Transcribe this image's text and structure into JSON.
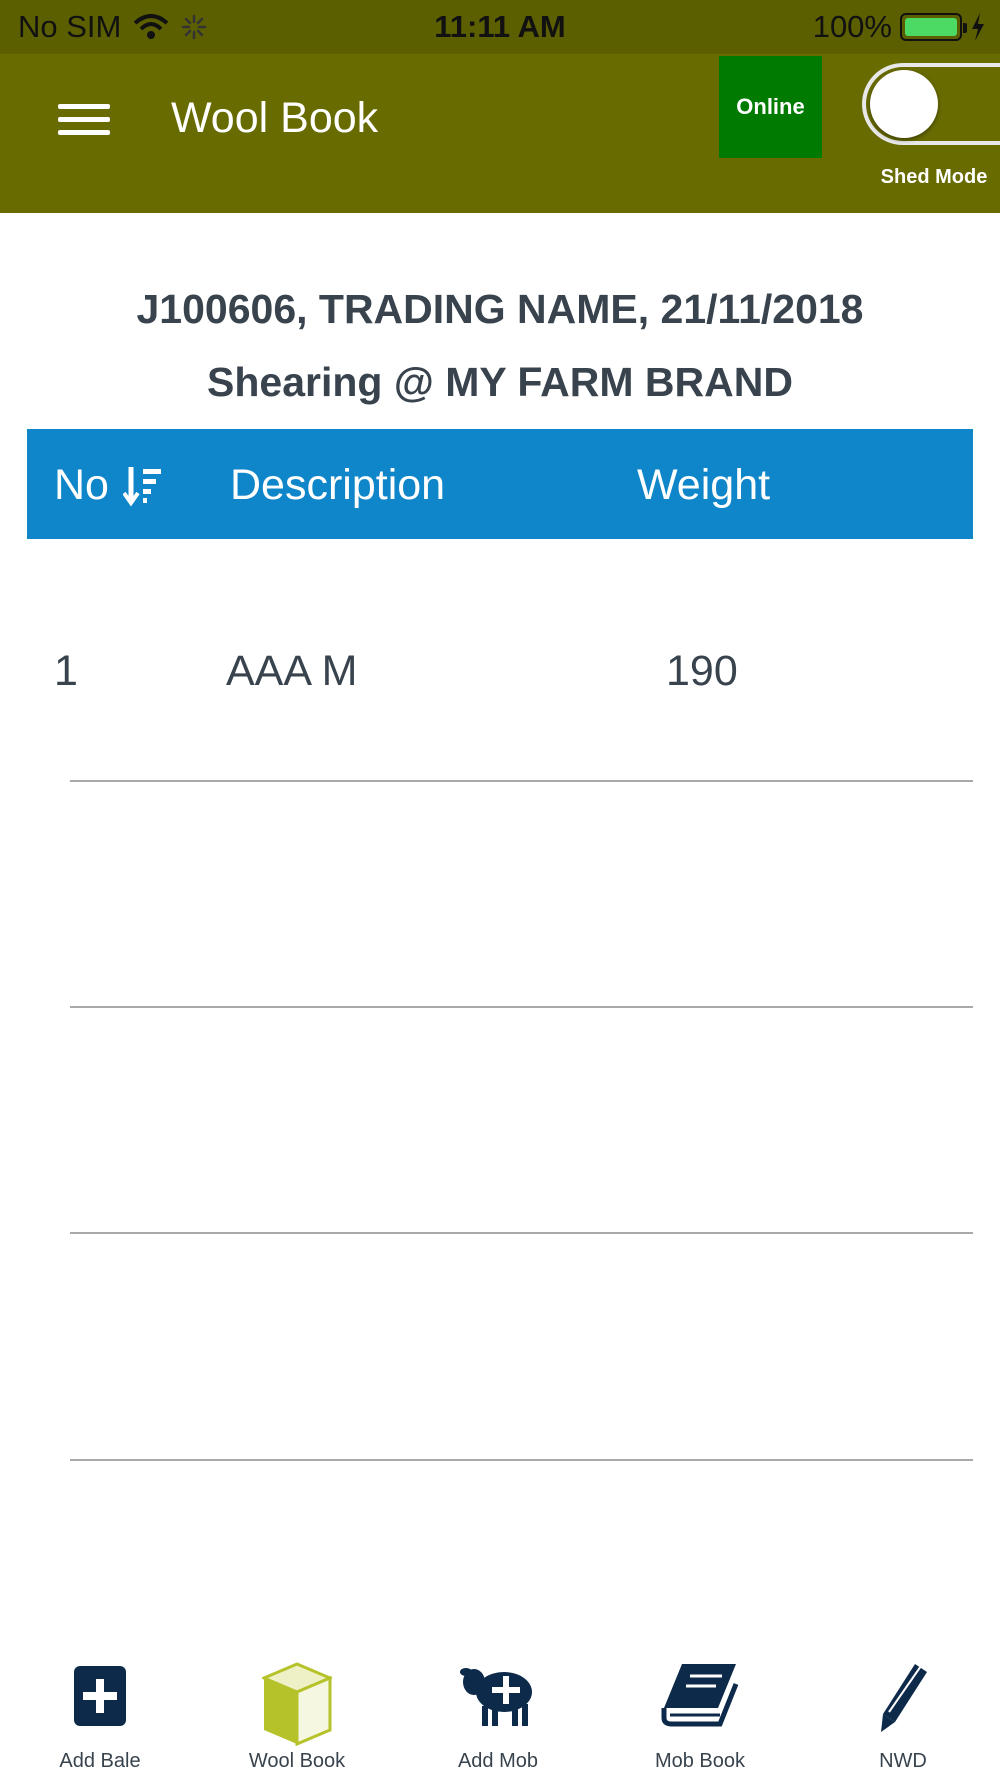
{
  "status_bar": {
    "carrier": "No SIM",
    "time": "11:11 AM",
    "battery_percent": "100%",
    "battery_level": 1.0
  },
  "header": {
    "title": "Wool Book",
    "online_label": "Online",
    "shed_mode_label": "Shed Mode",
    "shed_mode_on": false
  },
  "job": {
    "title": "J100606, TRADING NAME, 21/11/2018",
    "subtitle": "Shearing @ MY FARM BRAND"
  },
  "table": {
    "columns": [
      "No",
      "Description",
      "Weight"
    ],
    "rows": [
      {
        "no": "1",
        "description": "AAA M",
        "weight": "190"
      }
    ]
  },
  "tabs": [
    {
      "label": "Add Bale",
      "icon": "add-bale-icon"
    },
    {
      "label": "Wool Book",
      "icon": "wool-book-icon",
      "active": true
    },
    {
      "label": "Add Mob",
      "icon": "add-mob-icon"
    },
    {
      "label": "Mob Book",
      "icon": "mob-book-icon"
    },
    {
      "label": "NWD",
      "icon": "nwd-icon"
    }
  ],
  "colors": {
    "status_bar": "#5c5f00",
    "header": "#686b00",
    "online": "#007a00",
    "table_header": "#0f86c9",
    "tab_icon": "#0d2a4a",
    "active_tab_icon": "#b6c22a"
  }
}
